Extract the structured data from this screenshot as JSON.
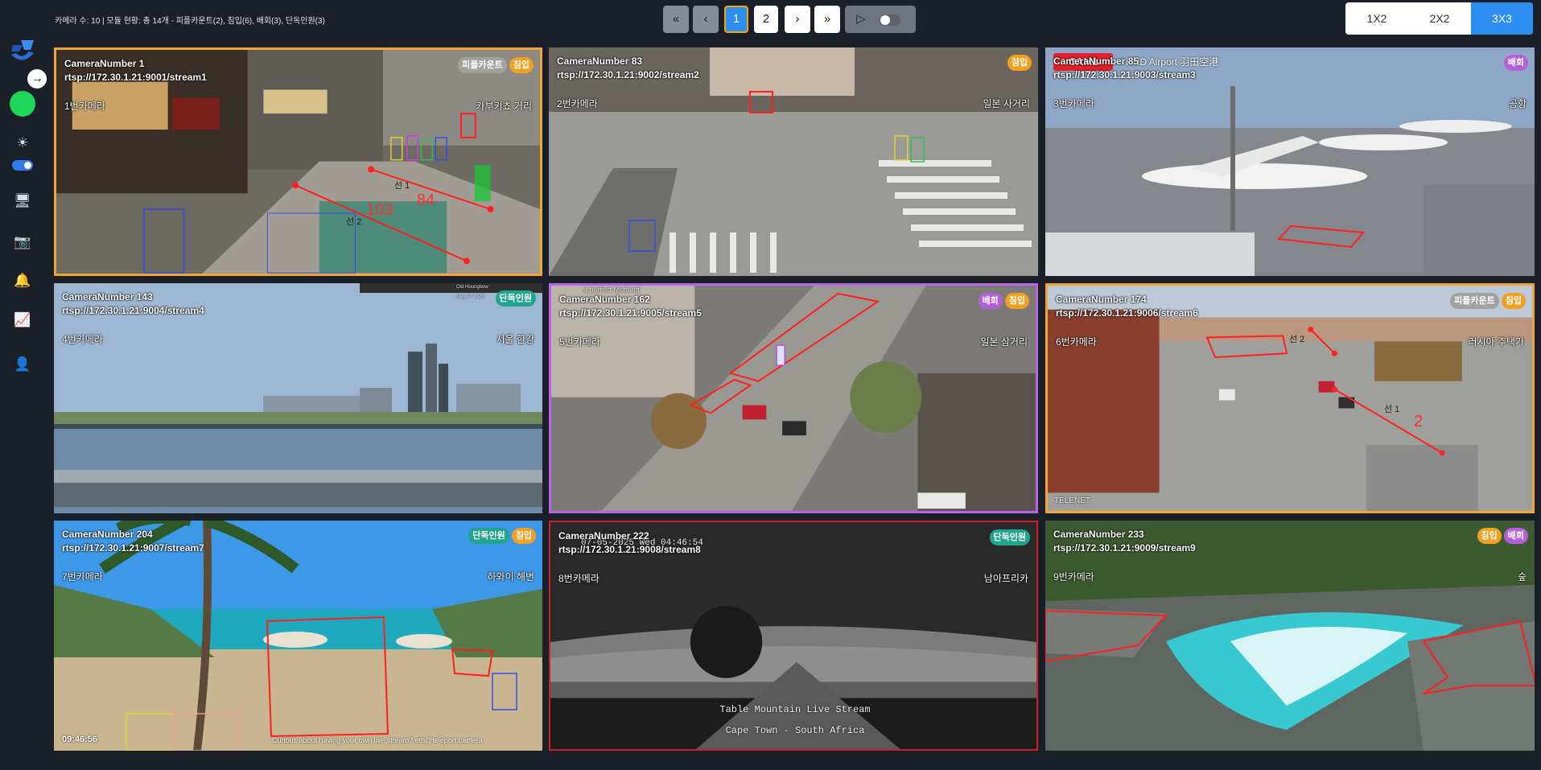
{
  "summary": "카메라 수: 10 | 모듈 현황: 총 14개 - 피플카운트(2), 침입(6), 배회(3), 단독인원(3)",
  "pagination": {
    "first": "«",
    "prev": "‹",
    "pages": [
      "1",
      "2"
    ],
    "next": "›",
    "last": "»",
    "play": "▷"
  },
  "layouts": [
    "1X2",
    "2X2",
    "3X3"
  ],
  "active_layout": "3X3",
  "sidebar": {
    "expand": "→",
    "icons": [
      "sun-icon",
      "monitor-icon",
      "camera-icon",
      "bell-icon",
      "chart-icon",
      "user-icon"
    ]
  },
  "cameras": [
    {
      "title": "CameraNumber 1",
      "url": "rtsp://172.30.1.21:9001/stream1",
      "name": "1번카메라",
      "location": "카부키쵸 거리",
      "badges": [
        "피플카운트",
        "침입"
      ],
      "overlay": [
        "선 1",
        "선 2",
        "103",
        "84"
      ]
    },
    {
      "title": "CameraNumber 83",
      "url": "rtsp://172.30.1.21:9002/stream2",
      "name": "2번카메라",
      "location": "일본 사거리",
      "badges": [
        "침입"
      ]
    },
    {
      "title": "CameraNumber 85",
      "url": "rtsp://172.30.1.21:9003/stream3",
      "name": "3번카메라",
      "location": "공항",
      "badges": [
        "배회"
      ],
      "overlay": [
        "CAM1",
        "HND Airport 羽田空港"
      ]
    },
    {
      "title": "CameraNumber 143",
      "url": "rtsp://172.30.1.21:9004/stream4",
      "name": "4번카메라",
      "location": "서울 한강",
      "badges": [
        "단독인원"
      ],
      "overlay": [
        "Old Houngbow",
        "May 07 2025"
      ]
    },
    {
      "title": "CameraNumber 162",
      "url": "rtsp://172.30.1.21:9005/stream5",
      "name": "5번카메라",
      "location": "일본 삼거리",
      "badges": [
        "배회",
        "침입"
      ],
      "overlay": [
        "a perfect Moment"
      ]
    },
    {
      "title": "CameraNumber 174",
      "url": "rtsp://172.30.1.21:9006/stream6",
      "name": "6번카메라",
      "location": "러시아 주택가",
      "badges": [
        "피플카운트",
        "침입"
      ],
      "overlay": [
        "선 1",
        "선 2",
        "2",
        "TELENET"
      ]
    },
    {
      "title": "CameraNumber 204",
      "url": "rtsp://172.30.1.21:9007/stream7",
      "name": "7번카메라",
      "location": "하와이 해변",
      "badges": [
        "단독인원",
        "침입"
      ],
      "overlay": [
        "09:46:56",
        "Curious about having your own live stream? eth@teleport.camera"
      ]
    },
    {
      "title": "CameraNumber 222",
      "url": "rtsp://172.30.1.21:9008/stream8",
      "name": "8번카메라",
      "location": "남아프리카",
      "badges": [
        "단독인원"
      ],
      "overlay": [
        "07-05-2025 Wed 04:46:54",
        "Table Mountain Live Stream",
        "Cape Town - South Africa"
      ]
    },
    {
      "title": "CameraNumber 233",
      "url": "rtsp://172.30.1.21:9009/stream9",
      "name": "9번카메라",
      "location": "숲",
      "badges": [
        "침입",
        "배회"
      ]
    }
  ],
  "colors": {
    "accent": "#2b8ef0",
    "intrusion": "#f2a020",
    "loitering": "#b45fd8",
    "single": "#21a58c",
    "people": "#a1a1a1",
    "zone": "#ff1f1f"
  }
}
